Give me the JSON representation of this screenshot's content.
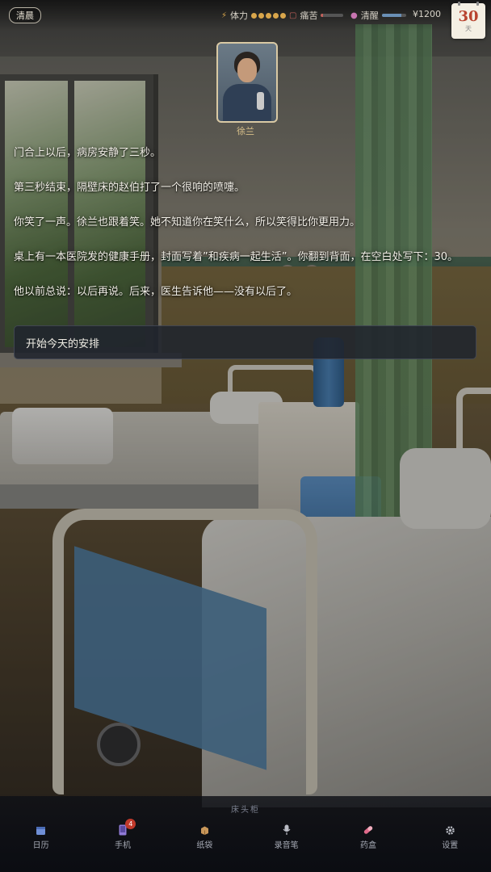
{
  "hud": {
    "time_of_day": "清晨",
    "stamina_label": "体力",
    "stamina_dots": 5,
    "stamina_color": "#d9a64b",
    "pain_label": "痛苦",
    "pain_level": 0.1,
    "pain_color": "#c0605a",
    "clarity_label": "清醒",
    "clarity_level": 0.8,
    "clarity_color": "#6a8fb5",
    "money": "¥1200",
    "calendar_day": "30",
    "calendar_unit": "天"
  },
  "character": {
    "name": "徐兰"
  },
  "narrative": [
    "门合上以后，病房安静了三秒。",
    "第三秒结束，隔壁床的赵伯打了一个很响的喷嚏。",
    "你笑了一声。徐兰也跟着笑。她不知道你在笑什么，所以笑得比你更用力。",
    "桌上有一本医院发的健康手册，封面写着”和疾病一起生活”。你翻到背面，在空白处写下：30。",
    "他以前总说：以后再说。后来，医生告诉他——没有以后了。"
  ],
  "action": {
    "label": "开始今天的安排"
  },
  "bottom_bar": {
    "location_label": "床头柜",
    "items": [
      {
        "label": "日历",
        "icon": "calendar-icon"
      },
      {
        "label": "手机",
        "icon": "phone-icon",
        "badge": "4"
      },
      {
        "label": "纸袋",
        "icon": "paper-bag-icon"
      },
      {
        "label": "录音笔",
        "icon": "voice-recorder-icon"
      },
      {
        "label": "药盒",
        "icon": "pill-box-icon"
      },
      {
        "label": "设置",
        "icon": "gear-icon"
      }
    ]
  }
}
